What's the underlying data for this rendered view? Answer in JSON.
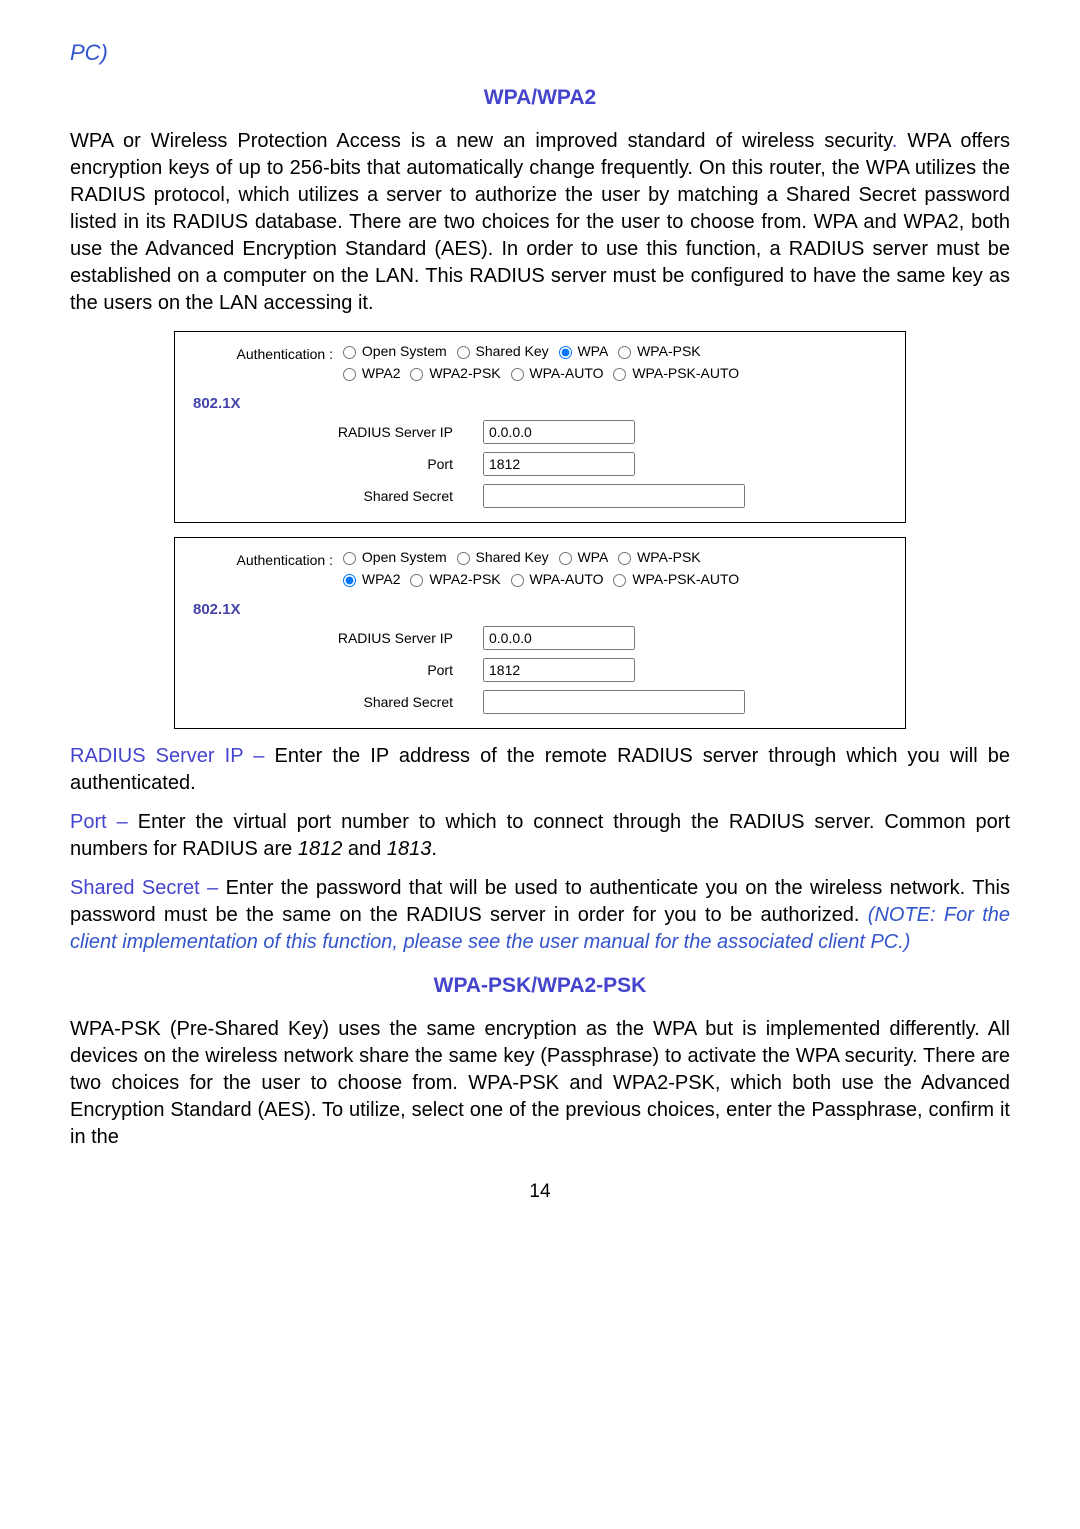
{
  "header_fragment": "PC)",
  "section1_title": "WPA/WPA2",
  "intro_before_period": "WPA or Wireless Protection Access is a new an improved standard of wireless security",
  "intro_period": ".",
  "intro_remaining": " WPA offers encryption keys of up to 256-bits that automatically change frequently. On this router, the WPA utilizes the RADIUS protocol, which utilizes a server to authorize the user by matching a Shared Secret password listed in its RADIUS database. There are two choices for the user to choose from. WPA and WPA2, both use the Advanced Encryption Standard (AES). In order to use this function, a RADIUS server must be established on a computer on the LAN. This RADIUS server must be configured to have the same key as the users on the LAN accessing it.",
  "auth_label": "Authentication :",
  "section_8021x": "802.1X",
  "radius_ip_label": "RADIUS Server IP",
  "port_label": "Port",
  "secret_label": "Shared Secret",
  "opts": {
    "open": "Open System",
    "shared": "Shared Key",
    "wpa": "WPA",
    "wpapsk": "WPA-PSK",
    "wpa2": "WPA2",
    "wpa2psk": "WPA2-PSK",
    "wpaauto": "WPA-AUTO",
    "wpapskauto": "WPA-PSK-AUTO"
  },
  "form1": {
    "ip": "0.0.0.0",
    "port": "1812",
    "secret": ""
  },
  "form2": {
    "ip": "0.0.0.0",
    "port": "1812",
    "secret": ""
  },
  "radius_term": "RADIUS Server IP – ",
  "radius_desc": "Enter the IP address of the remote RADIUS server through which you will be authenticated.",
  "port_term": "Port – ",
  "port_desc_a": "Enter the virtual port number to which to connect through the RADIUS server. Common port numbers for RADIUS are ",
  "port_desc_b": "1812",
  "port_desc_c": " and ",
  "port_desc_d": "1813",
  "port_desc_e": ".",
  "secret_term": "Shared Secret – ",
  "secret_desc": "Enter the password that will be used to authenticate you on the wireless network. This password must be the same on the RADIUS server in order for you to be authorized. ",
  "secret_note": "(NOTE: For the client implementation of this function, please see the user manual for the associated client PC.)",
  "section2_title": "WPA-PSK/WPA2-PSK",
  "psk_desc": "WPA-PSK (Pre-Shared Key) uses the same encryption as the WPA but is implemented differently. All devices on the wireless network share the same key (Passphrase) to activate the WPA security. There are two choices for the user to choose from. WPA-PSK and WPA2-PSK, which both use the Advanced Encryption Standard (AES). To utilize, select one of the previous choices, enter the Passphrase, confirm it in the",
  "page_number": "14"
}
